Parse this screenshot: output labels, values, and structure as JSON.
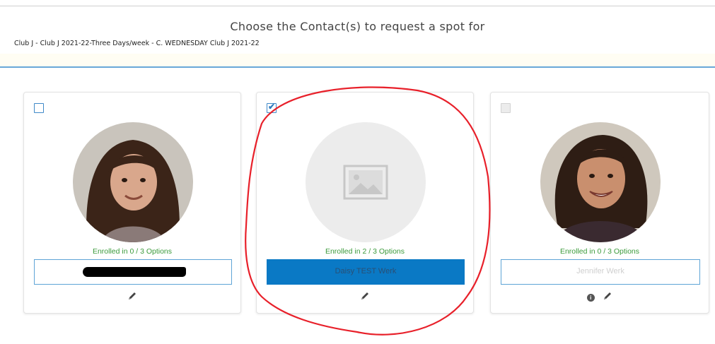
{
  "header": {
    "title": "Choose the Contact(s) to request a spot for",
    "subtitle": "Club J - Club J 2021-22-Three Days/week - C. WEDNESDAY Club J 2021-22"
  },
  "contacts": [
    {
      "enrolled_text": "Enrolled in 0 / 3 Options",
      "name": "",
      "checked": false,
      "name_redacted": true
    },
    {
      "enrolled_text": "Enrolled in 2 / 3 Options",
      "name": "Daisy TEST Werk",
      "checked": true,
      "photo": "placeholder-image-icon"
    },
    {
      "enrolled_text": "Enrolled in 0 / 3 Options",
      "name": "Jennifer Werk",
      "checked": false,
      "disabled": true
    }
  ],
  "colors": {
    "accent_blue": "#0a79c5",
    "enrolled_green": "#3a9a3a",
    "annotation_red": "#e8202a"
  }
}
